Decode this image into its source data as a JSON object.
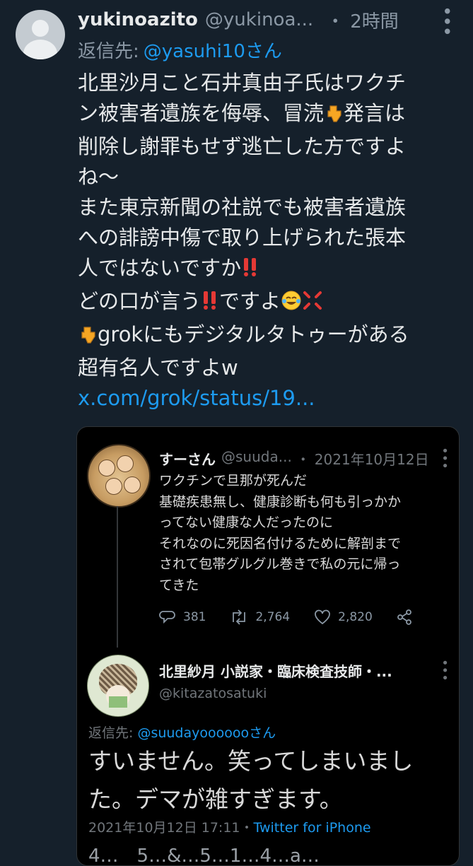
{
  "tweet": {
    "display_name": "yukinoazito",
    "handle": "@yukinoa...",
    "separator": "・",
    "time": "2時間",
    "reply_prefix": "返信先:",
    "reply_mention": "@yasuhi10さん",
    "text": {
      "line1": "北里沙月こと石井真由子氏はワクチ",
      "line2a": "ン被害者遺族を侮辱、冒涜",
      "line2b": "発言は",
      "line3": "削除し謝罪もせず逃亡した方ですよ",
      "line4": "ね〜",
      "line5": "また東京新聞の社説でも被害者遺族",
      "line6": "への誹謗中傷で取り上げられた張本",
      "line7": "人ではないですか",
      "line8a": "どの口が言う",
      "line8b": "ですよ",
      "line9": "grokにもデジタルタトゥーがある",
      "line10": "超有名人ですよw",
      "link": "x.com/grok/status/19..."
    }
  },
  "quote": {
    "first": {
      "name": "すーさん",
      "handle": "@suuda...",
      "separator": "・",
      "time": "2021年10月12日",
      "lines": [
        "ワクチンで旦那が死んだ",
        "基礎疾患無し、健康診断も何も引っかか",
        "ってない健康な人だったのに",
        "それなのに死因名付けるために解剖まで",
        "されて包帯グルグル巻きで私の元に帰っ",
        "てきた"
      ],
      "replies": "381",
      "retweets": "2,764",
      "likes": "2,820"
    },
    "second": {
      "name": "北里紗月 小説家・臨床検査技師・...",
      "handle": "@kitazatosatuki",
      "reply_prefix": "返信先:",
      "reply_mention": "@suudayoooooo",
      "reply_suffix": "さん",
      "line1": "すいません。笑ってしまいまし",
      "line2": "た。デマが雑すぎます。",
      "timestamp": "2021年10月12日 17:11",
      "meta_sep": "・",
      "via": "Twitter for iPhone",
      "cut_off_text": "4…　5…&…5…1…4…a…"
    }
  },
  "colors": {
    "background": "#15202b",
    "link": "#1d9bf0",
    "muted": "#8b98a5",
    "quote_bg": "#000000"
  },
  "icons": {
    "more": "more-vertical-icon",
    "reply": "reply-icon",
    "retweet": "retweet-icon",
    "like": "heart-icon",
    "share": "share-icon",
    "point_down": "backhand-index-pointing-down-emoji",
    "double_exclaim": "double-exclamation-emoji",
    "joy": "face-with-tears-of-joy-emoji",
    "anger": "anger-symbol-emoji"
  }
}
